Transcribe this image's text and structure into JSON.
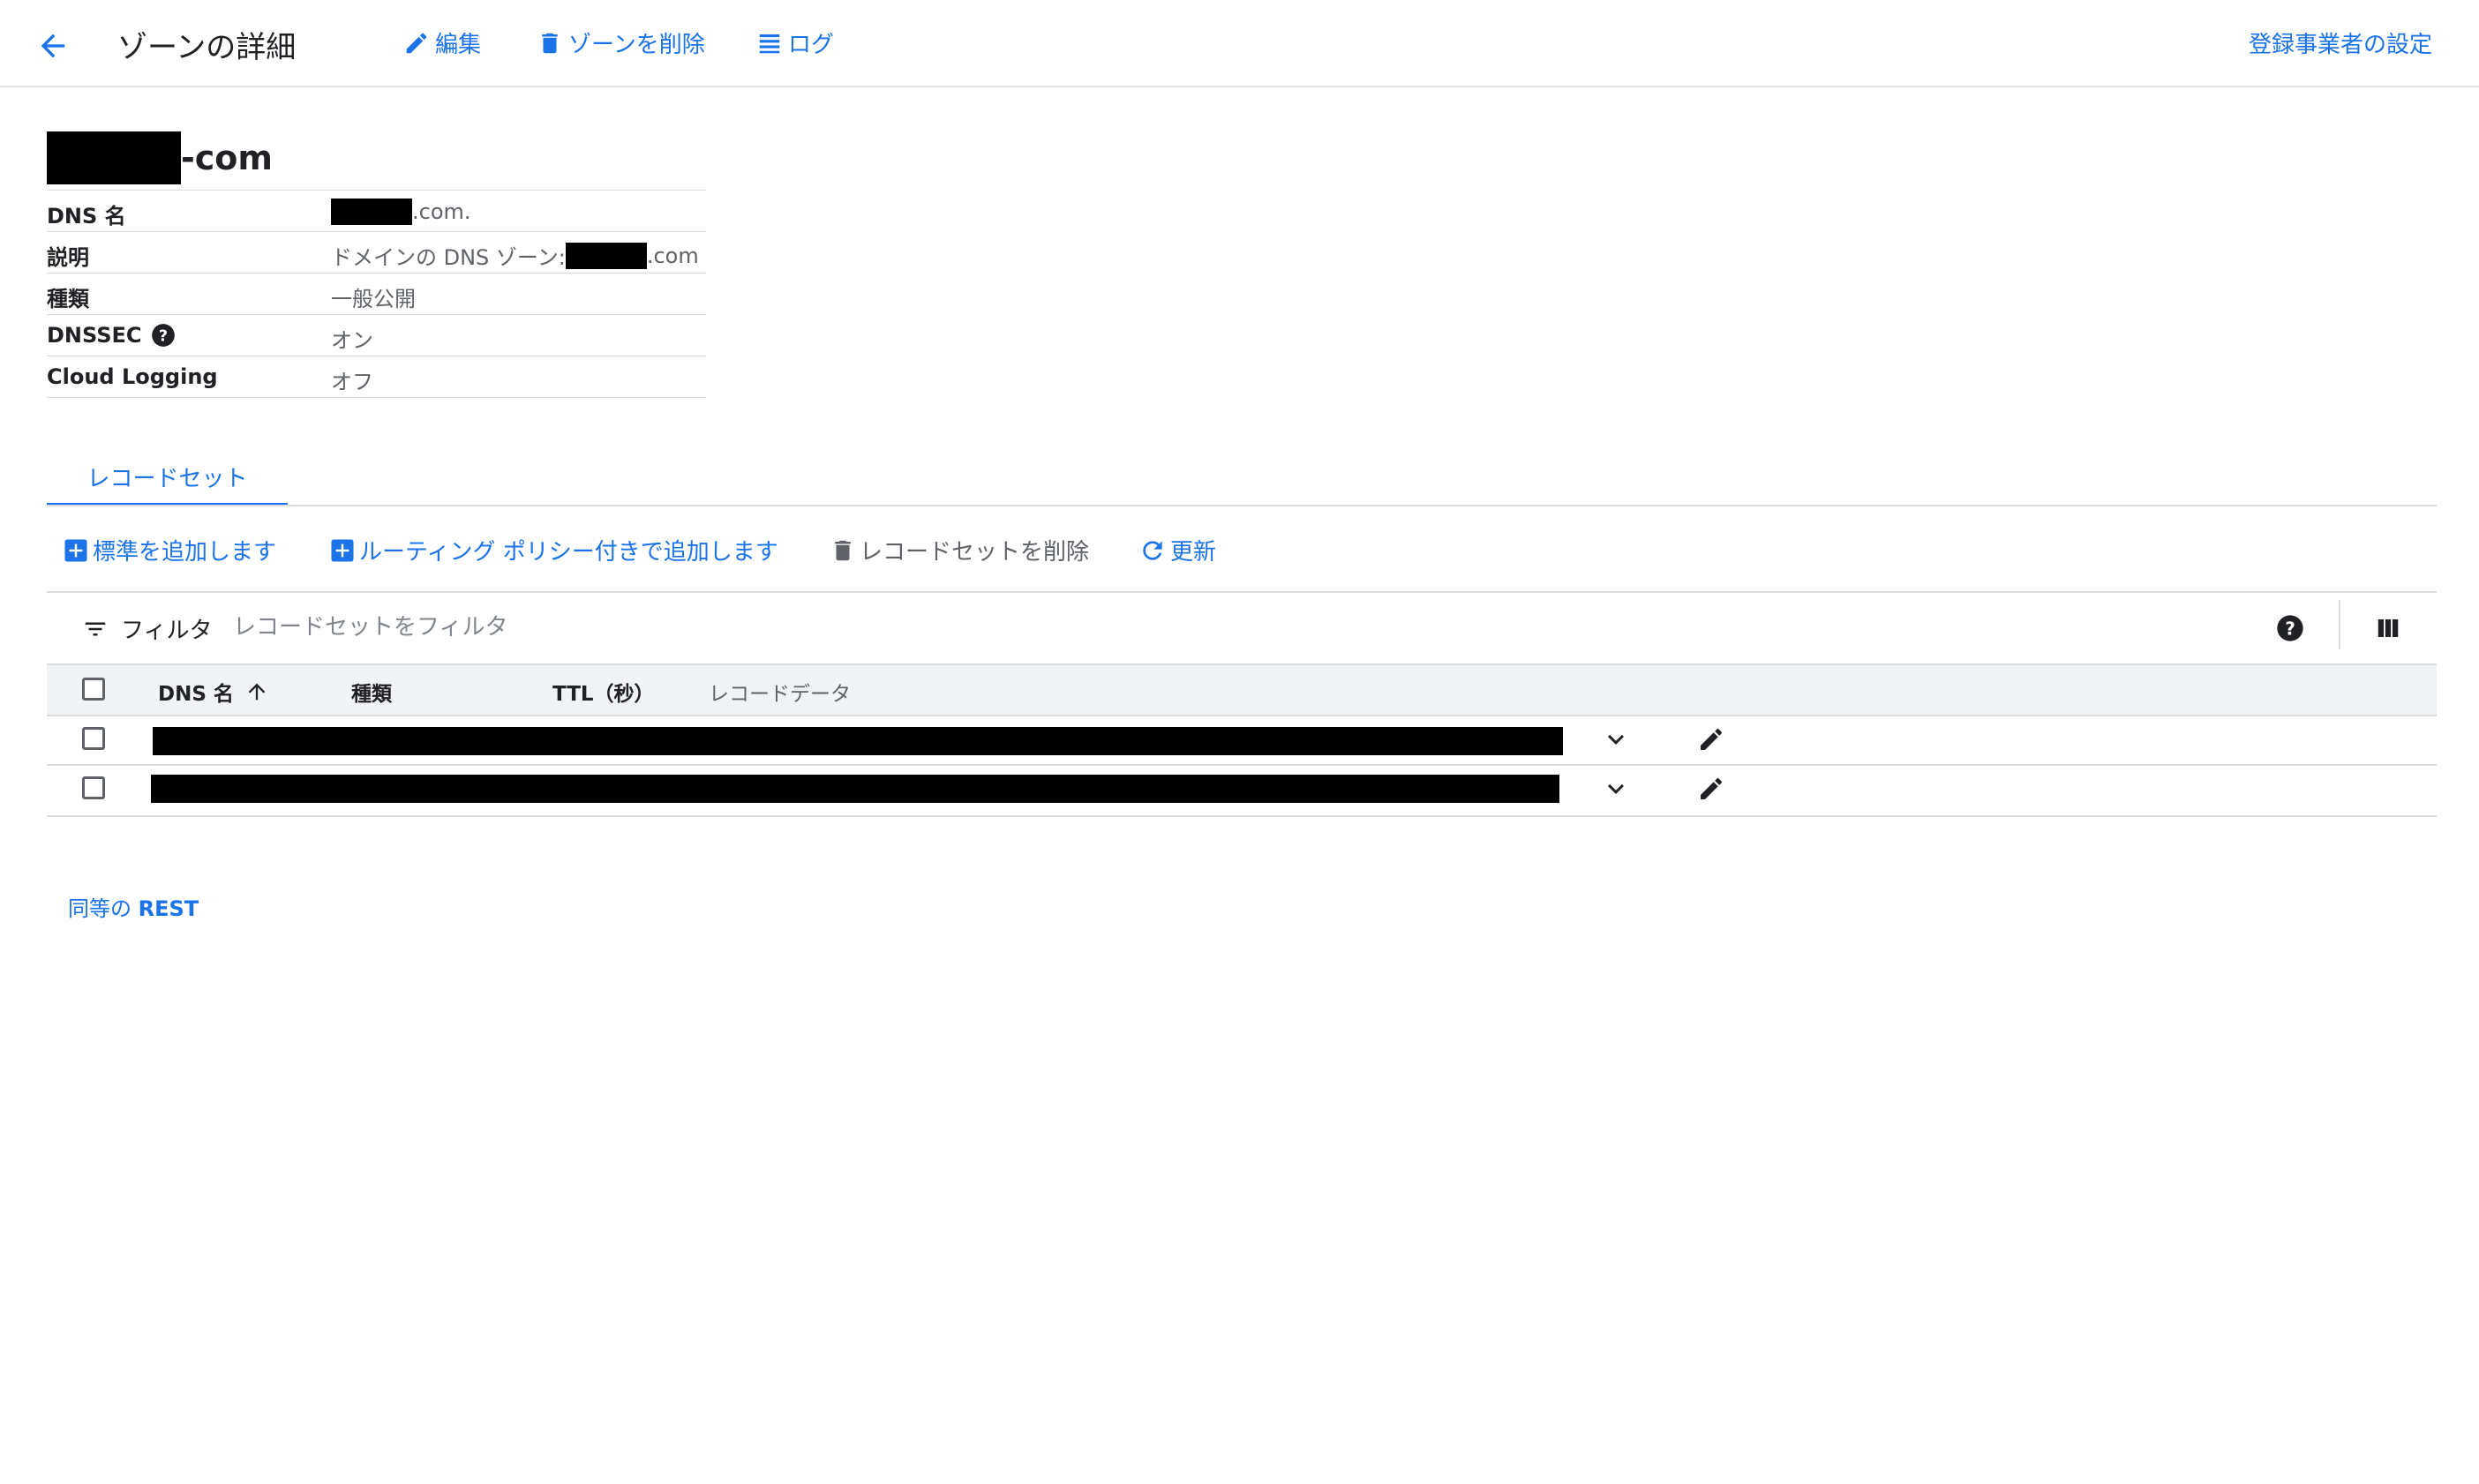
{
  "header": {
    "title": "ゾーンの詳細",
    "edit_label": "編集",
    "delete_zone_label": "ゾーンを削除",
    "logs_label": "ログ",
    "registrar_label": "登録事業者の設定"
  },
  "zone": {
    "name_suffix": "-com",
    "fields": [
      {
        "key": "DNS 名",
        "value": ".com."
      },
      {
        "key": "説明",
        "value": "ドメインの DNS ゾーン: ",
        "value_suffix": ".com"
      },
      {
        "key": "種類",
        "value": "一般公開"
      },
      {
        "key": "DNSSEC",
        "value": "オン"
      },
      {
        "key": "Cloud Logging",
        "value": "オフ"
      }
    ]
  },
  "tabs": [
    {
      "label": "レコードセット"
    }
  ],
  "actions": {
    "add_standard": "標準を追加します",
    "add_routing": "ルーティング ポリシー付きで追加します",
    "delete_recordsets": "レコードセットを削除",
    "refresh": "更新"
  },
  "filter": {
    "label": "フィルタ",
    "placeholder": "レコードセットをフィルタ"
  },
  "table": {
    "columns": [
      "DNS 名",
      "種類",
      "TTL（秒）",
      "レコードデータ"
    ],
    "row_count": 2
  },
  "footer": {
    "rest_prefix": "同等の",
    "rest_label": "REST"
  },
  "colors": {
    "accent": "#1a73e8",
    "text_primary": "#202124",
    "text_secondary": "#5f6368",
    "divider": "#dadce0",
    "table_header_bg": "#f1f3f4"
  }
}
